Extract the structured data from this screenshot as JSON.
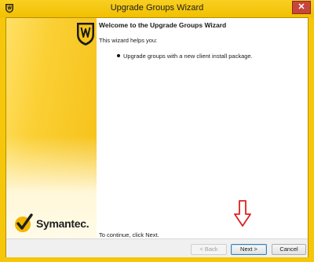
{
  "window": {
    "title": "Upgrade Groups Wizard",
    "close_label": "✕"
  },
  "banner": {
    "brand_name": "Symantec.",
    "shield_icon": "symantec-shield-icon",
    "check_icon": "symantec-check-icon"
  },
  "content": {
    "heading": "Welcome to the Upgrade Groups Wizard",
    "intro": "This wizard helps you:",
    "bullets": [
      "Upgrade groups with a new client install package."
    ],
    "continue_text": "To continue, click Next."
  },
  "buttons": {
    "back": "< Back",
    "next": "Next >",
    "cancel": "Cancel"
  },
  "annotation": {
    "icon": "red-down-arrow-icon",
    "color": "#e02020"
  },
  "colors": {
    "brand_yellow": "#f5c60a"
  }
}
